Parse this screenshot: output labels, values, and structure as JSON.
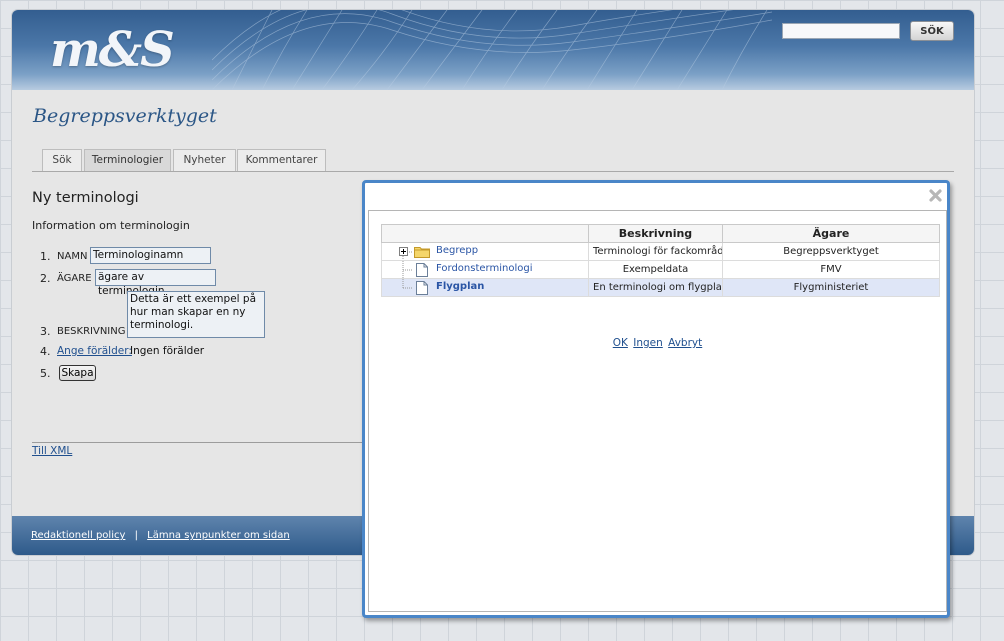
{
  "header": {
    "logo_text": "m&S",
    "search": {
      "value": "",
      "placeholder": ""
    },
    "search_button_label": "SÖK"
  },
  "app_title": "Begreppsverktyget",
  "tabs": [
    {
      "label": "Sök",
      "active": false
    },
    {
      "label": "Terminologier",
      "active": true
    },
    {
      "label": "Nyheter",
      "active": false
    },
    {
      "label": "Kommentarer",
      "active": false
    }
  ],
  "form": {
    "title": "Ny terminologi",
    "info": "Information om terminologin",
    "fields": [
      {
        "number": "1.",
        "label": "NAMN",
        "value": "Terminologinamn"
      },
      {
        "number": "2.",
        "label": "ÄGARE",
        "value": "ägare av terminologin."
      },
      {
        "number": "3.",
        "label": "BESKRIVNING",
        "value": "Detta är ett exempel på hur man skapar en ny terminologi."
      },
      {
        "number": "4.",
        "link": "Ange förälder:",
        "value": "Ingen förälder"
      },
      {
        "number": "5.",
        "button": "Skapa"
      }
    ]
  },
  "xml_link": "Till XML",
  "footer": {
    "links": [
      "Redaktionell policy",
      "Lämna synpunkter om sidan"
    ],
    "separator": "|"
  },
  "dialog": {
    "columns": [
      "",
      "Beskrivning",
      "Ägare"
    ],
    "rows": [
      {
        "name": "Begrepp",
        "description": "Terminologi för fackområde",
        "owner": "Begreppsverktyget",
        "type": "folder",
        "expandable": true,
        "selected": false
      },
      {
        "name": "Fordonsterminologi",
        "description": "Exempeldata",
        "owner": "FMV",
        "type": "document",
        "expandable": false,
        "selected": false
      },
      {
        "name": "Flygplan",
        "description": "En terminologi om flygplan",
        "owner": "Flygministeriet",
        "type": "document",
        "expandable": false,
        "selected": true
      }
    ],
    "actions": {
      "ok": "OK",
      "none": "Ingen",
      "cancel": "Avbryt"
    }
  },
  "colors": {
    "header_blue": "#335e90",
    "link_blue": "#1f4f8e",
    "dialog_border": "#4a86c8",
    "selected_row": "#dfe6f7"
  }
}
